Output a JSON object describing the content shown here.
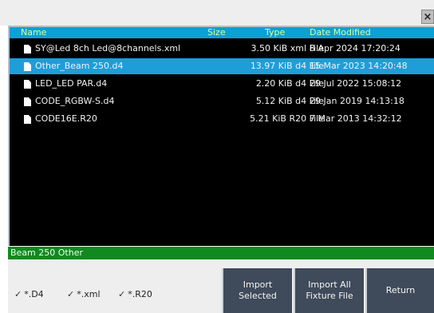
{
  "window": {
    "close_label": "×"
  },
  "columns": {
    "name": "Name",
    "size": "Size",
    "type": "Type",
    "date": "Date Modified"
  },
  "files": [
    {
      "name": "SY@Led 8ch Led@8channels.xml",
      "size_type": "3.50 KiB xml File",
      "date": "8 Apr 2024 17:20:24",
      "selected": false
    },
    {
      "name": "Other_Beam 250.d4",
      "size_type": "13.97 KiB d4 File",
      "date": "15 Mar 2023 14:20:48",
      "selected": true
    },
    {
      "name": "LED_LED PAR.d4",
      "size_type": "2.20 KiB d4 File",
      "date": "29 Jul 2022 15:08:12",
      "selected": false
    },
    {
      "name": "CODE_RGBW-S.d4",
      "size_type": "5.12 KiB d4 File",
      "date": "29 Jan 2019 14:13:18",
      "selected": false
    },
    {
      "name": "CODE16E.R20",
      "size_type": "5.21 KiB R20 File",
      "date": "7 Mar 2013 14:32:12",
      "selected": false
    }
  ],
  "status": {
    "text": "Beam 250 Other"
  },
  "filters": [
    {
      "label": "*.D4",
      "checked": true
    },
    {
      "label": "*.xml",
      "checked": true
    },
    {
      "label": "*.R20",
      "checked": true
    }
  ],
  "buttons": {
    "import_selected": "Import\nSelected",
    "import_all": "Import All\nFixture File",
    "return": "Return"
  },
  "colors": {
    "header_bg": "#0aa0d8",
    "header_text": "#d9ff9a",
    "selected_row": "#1e9ed8",
    "status_bg": "#0f8a1e",
    "button_bg": "#3f4a5a"
  }
}
